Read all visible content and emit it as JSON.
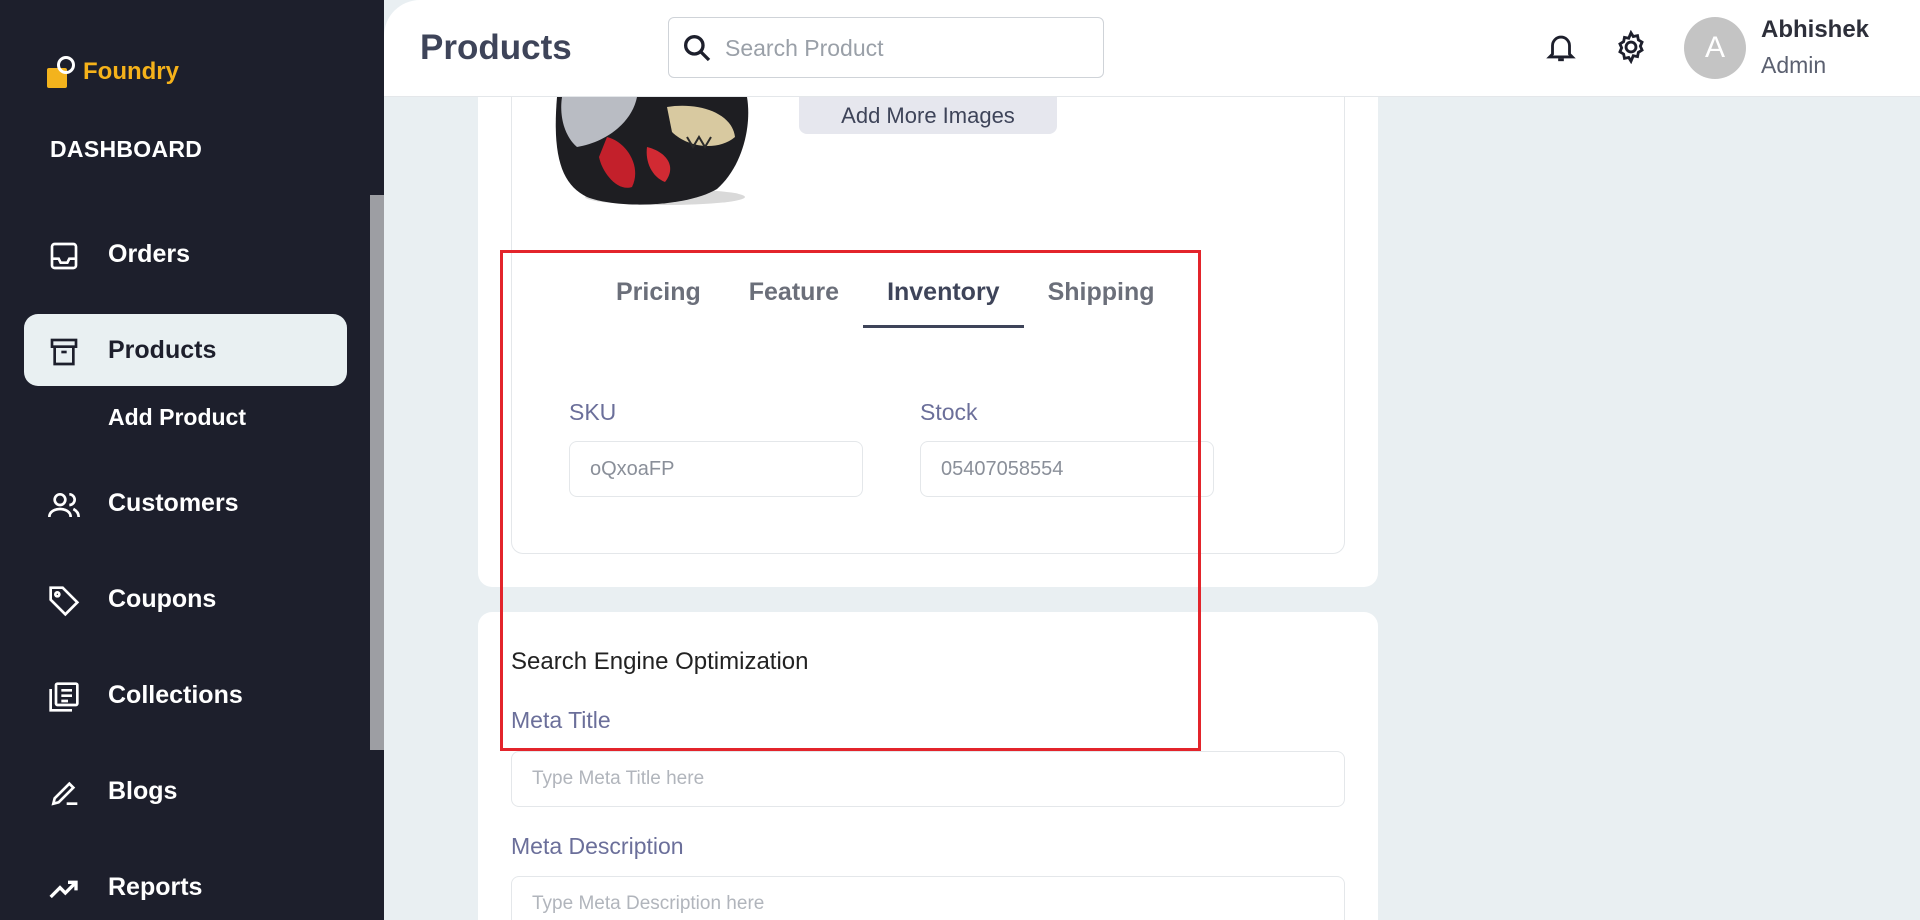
{
  "sidebar": {
    "brand": "Foundry",
    "section_label": "DASHBOARD",
    "items": [
      {
        "label": "Orders"
      },
      {
        "label": "Products"
      },
      {
        "label": "Customers"
      },
      {
        "label": "Coupons"
      },
      {
        "label": "Collections"
      },
      {
        "label": "Blogs"
      },
      {
        "label": "Reports"
      }
    ],
    "sub_items": [
      {
        "label": "Add Product"
      }
    ]
  },
  "header": {
    "title": "Products",
    "search_placeholder": "Search Product",
    "user": {
      "initial": "A",
      "name": "Abhishek",
      "role": "Admin"
    }
  },
  "product_images": {
    "add_more_label": "Add More Images"
  },
  "tabs": [
    {
      "label": "Pricing",
      "active": false
    },
    {
      "label": "Feature",
      "active": false
    },
    {
      "label": "Inventory",
      "active": true
    },
    {
      "label": "Shipping",
      "active": false
    }
  ],
  "inventory": {
    "sku_label": "SKU",
    "sku_value": "oQxoaFP",
    "stock_label": "Stock",
    "stock_value": "05407058554"
  },
  "seo": {
    "title": "Search Engine Optimization",
    "meta_title_label": "Meta Title",
    "meta_title_placeholder": "Type Meta Title here",
    "meta_description_label": "Meta Description",
    "meta_description_placeholder": "Type Meta Description here"
  },
  "colors": {
    "sidebar_bg": "#1d1f2c",
    "brand": "#f6b21a",
    "page_bg": "#e9eff2",
    "highlight": "#e3242b"
  }
}
